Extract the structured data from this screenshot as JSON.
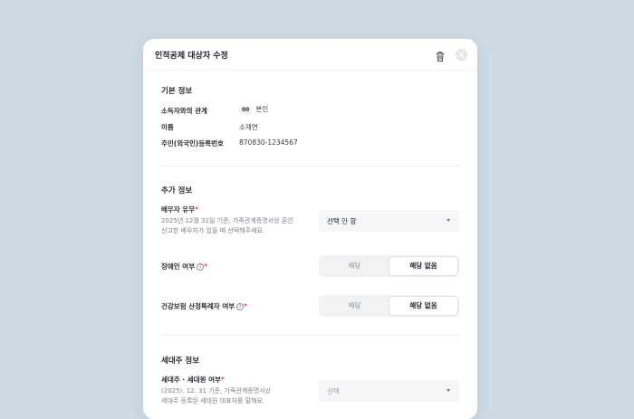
{
  "modal": {
    "title": "인적공제 대상자 수정",
    "trash_icon": "trash-icon",
    "close_icon": "close-icon"
  },
  "basic": {
    "title": "기본 정보",
    "relation_label": "소득자와의 관계",
    "relation_code": "00",
    "relation_value": "본인",
    "name_label": "이름",
    "name_value": "소재연",
    "id_label": "주민(외국인)등록번호",
    "id_value": "870830-1234567"
  },
  "additional": {
    "title": "추가 정보",
    "spouse_label": "배우자 유무",
    "spouse_help_line1": "2025년 12월 31일 기준, 가족관계증명서상 혼인",
    "spouse_help_line2": "신고한 배우자가 있을 때 선택해주세요.",
    "spouse_select": "선택 안 함",
    "disabled_label": "장애인 여부",
    "disabled_options": [
      "해당",
      "해당 없음"
    ],
    "disabled_selected": "해당 없음",
    "health_label": "건강보험 산정특례자 여부",
    "health_options": [
      "해당",
      "해당 없음"
    ],
    "health_selected": "해당 없음",
    "required_mark": "*"
  },
  "household": {
    "title": "세대주 정보",
    "head_label": "세대주 · 세대원 여부",
    "head_help_line1": "(2025). 12. 31 기준, 가족관계증명서상",
    "head_help_line2": "세대주 등록된 세대원 대표자를 말해요.",
    "head_select_placeholder": "선택"
  },
  "colors": {
    "background": "#cfdbe3",
    "required": "#e34b4b",
    "segment_bg": "#f0f2f4"
  }
}
